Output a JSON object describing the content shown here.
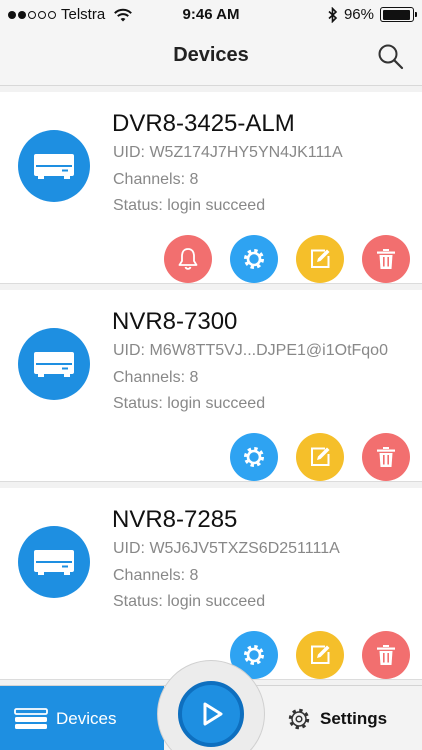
{
  "status_bar": {
    "carrier": "Telstra",
    "time": "9:46 AM",
    "battery_percent": "96%",
    "battery_level": 0.96,
    "signal_bars": 2
  },
  "nav": {
    "title": "Devices",
    "search_icon": "search-icon"
  },
  "devices": [
    {
      "name": "DVR8-3425-ALM",
      "uid": "UID: W5Z174J7HY5YN4JK111A",
      "channels": "Channels: 8",
      "status": "Status: login succeed",
      "has_alarm": true
    },
    {
      "name": "NVR8-7300",
      "uid": "UID: M6W8TT5VJ...DJPE1@i1OtFqo0",
      "channels": "Channels: 8",
      "status": "Status: login succeed",
      "has_alarm": false
    },
    {
      "name": "NVR8-7285",
      "uid": "UID: W5J6JV5TXZS6D251111A",
      "channels": "Channels: 8",
      "status": "Status: login succeed",
      "has_alarm": false
    }
  ],
  "tab_bar": {
    "devices_label": "Devices",
    "settings_label": "Settings"
  },
  "colors": {
    "primary_blue": "#1e8fe1",
    "alarm_red": "#f26f6f",
    "settings_blue": "#2ea3f2",
    "edit_yellow": "#f5bf2a",
    "delete_red": "#f26f6f"
  }
}
